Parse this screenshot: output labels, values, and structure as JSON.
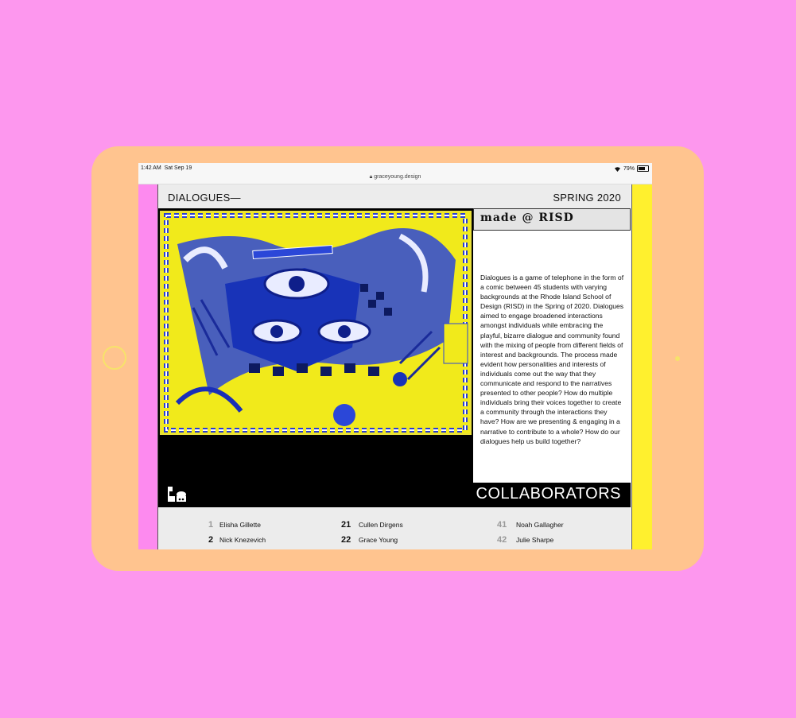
{
  "status_bar": {
    "time": "1:42 AM",
    "date": "Sat Sep 19",
    "battery": "79%",
    "url": "graceyoung.design"
  },
  "page": {
    "title": "DIALOGUES—",
    "season": "SPRING 2020"
  },
  "panel": {
    "made_at": "made @ RISD",
    "description": "Dialogues is a game of telephone in the form of a comic between 45 students with varying backgrounds at the Rhode Island School of Design (RISD) in the Spring of 2020. Dialogues aimed to engage broadened interactions amongst individuals while embracing the playful, bizarre dialogue and community found with the mixing of people from different fields of interest and backgrounds. The process made evident how personalities and interests of individuals come out the way that they communicate and respond to the narratives presented to other people? How do multiple individuals bring their voices together to create a community through the interactions they have? How are we presenting & engaging in a narrative to contribute to a whole? How do our dialogues help us build together?"
  },
  "collaborators": {
    "heading": "COLLABORATORS",
    "people": [
      {
        "num": "1",
        "name": "Elisha Gillette"
      },
      {
        "num": "2",
        "name": "Nick Knezevich"
      },
      {
        "num": "21",
        "name": "Cullen Dirgens"
      },
      {
        "num": "22",
        "name": "Grace Young"
      },
      {
        "num": "41",
        "name": "Noah Gallagher"
      },
      {
        "num": "42",
        "name": "Julie Sharpe"
      }
    ]
  },
  "icons": [
    "prev-arrow-icon",
    "next-arrow-icon",
    "wifi-icon",
    "battery-icon",
    "lock-icon"
  ],
  "colors": {
    "background": "#fd97ee",
    "device": "#ffc48f",
    "left_bar": "#fd8aef",
    "right_bar": "#fff02e",
    "art_yellow": "#f1ea1b",
    "art_blue": "#1c3fcf"
  }
}
